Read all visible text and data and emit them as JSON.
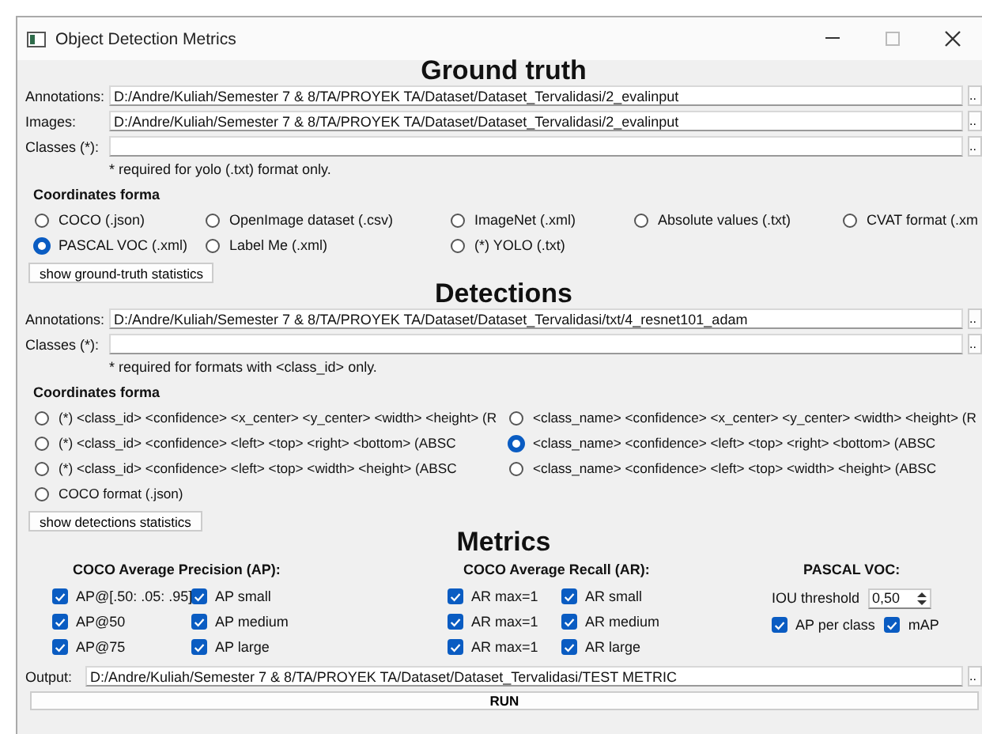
{
  "window": {
    "title": "Object Detection Metrics",
    "controls": [
      {
        "kind": "minimize"
      },
      {
        "kind": "maximize",
        "disabled": true
      },
      {
        "kind": "close"
      }
    ]
  },
  "ground_truth": {
    "heading": "Ground truth",
    "fields": [
      {
        "label": "Annotations:",
        "value": "D:/Andre/Kuliah/Semester 7 & 8/TA/PROYEK TA/Dataset/Dataset_Tervalidasi/2_evalinput",
        "browse": ".."
      },
      {
        "label": "Images:",
        "value": "D:/Andre/Kuliah/Semester 7 & 8/TA/PROYEK TA/Dataset/Dataset_Tervalidasi/2_evalinput",
        "browse": ".."
      },
      {
        "label": "Classes (*):",
        "browse": ".."
      }
    ],
    "note": "* required for yolo (.txt) format only.",
    "formats_heading": "Coordinates forma",
    "formats": [
      {
        "label": "COCO (.json)",
        "selected": false
      },
      {
        "label": "OpenImage dataset (.csv)",
        "selected": false
      },
      {
        "label": "ImageNet (.xml)",
        "selected": false
      },
      {
        "label": "Absolute values (.txt)",
        "selected": false
      },
      {
        "label": "CVAT format (.xm",
        "selected": false
      },
      {
        "label": "PASCAL VOC (.xml)",
        "selected": true
      },
      {
        "label": "Label Me (.xml)",
        "selected": false
      },
      {
        "label": "(*) YOLO (.txt)",
        "selected": false
      }
    ],
    "stats_button": "show ground-truth statistics"
  },
  "detections": {
    "heading": "Detections",
    "fields": [
      {
        "label": "Annotations:",
        "value": "D:/Andre/Kuliah/Semester 7 & 8/TA/PROYEK TA/Dataset/Dataset_Tervalidasi/txt/4_resnet101_adam",
        "browse": ".."
      },
      {
        "label": "Classes (*):",
        "browse": ".."
      }
    ],
    "note": "* required for formats with <class_id> only.",
    "formats_heading": "Coordinates forma",
    "formats": [
      {
        "label": "(*) <class_id> <confidence> <x_center> <y_center> <width> <height> (R",
        "selected": false
      },
      {
        "label": "<class_name> <confidence> <x_center> <y_center> <width> <height> (R",
        "selected": false
      },
      {
        "label": "(*) <class_id> <confidence> <left> <top> <right> <bottom> (ABSC",
        "selected": false
      },
      {
        "label": "<class_name> <confidence> <left> <top> <right> <bottom> (ABSC",
        "selected": true
      },
      {
        "label": "(*) <class_id> <confidence> <left> <top> <width> <height> (ABSC",
        "selected": false
      },
      {
        "label": "<class_name> <confidence> <left> <top> <width> <height> (ABSC",
        "selected": false
      },
      {
        "label": "COCO format (.json)",
        "selected": false
      }
    ],
    "stats_button": "show detections statistics"
  },
  "metrics": {
    "heading": "Metrics",
    "groups": [
      {
        "kind": "checks",
        "title": "COCO Average Precision (AP):",
        "checks": [
          {
            "label": "AP@[.50: .05: .95]",
            "checked": true
          },
          {
            "label": "AP small",
            "checked": true
          },
          {
            "label": "AP@50",
            "checked": true
          },
          {
            "label": "AP medium",
            "checked": true
          },
          {
            "label": "AP@75",
            "checked": true
          },
          {
            "label": "AP large",
            "checked": true
          }
        ]
      },
      {
        "kind": "checks",
        "title": "COCO Average Recall (AR):",
        "checks": [
          {
            "label": "AR max=1",
            "checked": true
          },
          {
            "label": "AR small",
            "checked": true
          },
          {
            "label": "AR max=1",
            "checked": true
          },
          {
            "label": "AR medium",
            "checked": true
          },
          {
            "label": "AR max=1",
            "checked": true
          },
          {
            "label": "AR large",
            "checked": true
          }
        ]
      },
      {
        "kind": "pascal",
        "title": "PASCAL VOC:",
        "threshold_label": "IOU threshold",
        "threshold": "0,50",
        "checks": [
          {
            "label": "AP per class",
            "checked": true
          },
          {
            "label": "mAP",
            "checked": true
          }
        ]
      }
    ]
  },
  "output": {
    "label": "Output:",
    "value": "D:/Andre/Kuliah/Semester 7 & 8/TA/PROYEK TA/Dataset/Dataset_Tervalidasi/TEST METRIC",
    "browse": ".."
  },
  "run_button": "RUN"
}
